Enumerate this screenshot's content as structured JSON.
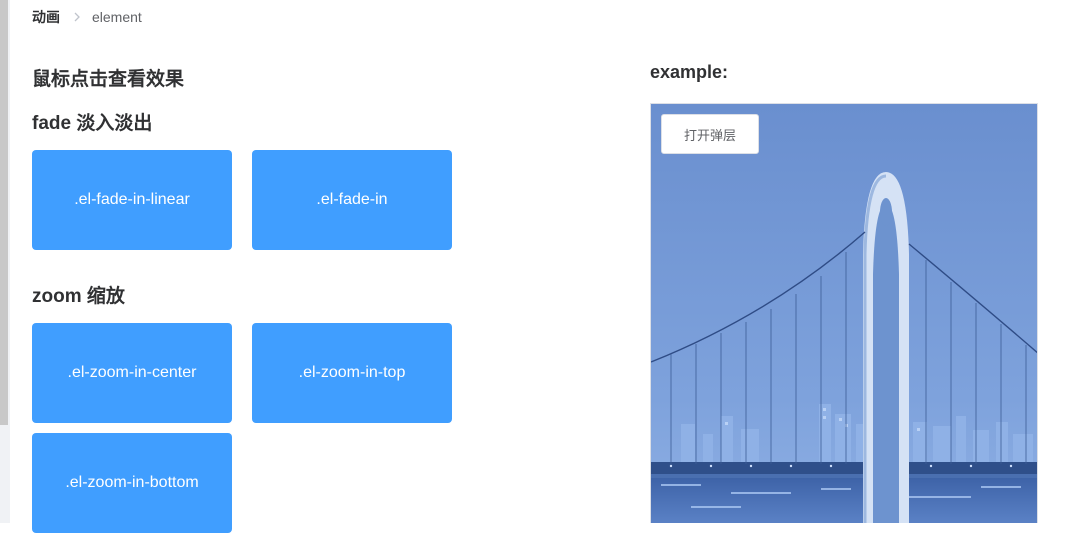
{
  "breadcrumb": {
    "root": "动画",
    "current": "element"
  },
  "main": {
    "heading": "鼠标点击查看效果",
    "fade": {
      "heading": "fade 淡入淡出",
      "boxes": [
        ".el-fade-in-linear",
        ".el-fade-in"
      ]
    },
    "zoom": {
      "heading": "zoom 缩放",
      "boxes": [
        ".el-zoom-in-center",
        ".el-zoom-in-top",
        ".el-zoom-in-bottom"
      ]
    }
  },
  "example": {
    "title": "example:",
    "open_button": "打开弹层"
  },
  "colors": {
    "primary": "#409eff",
    "text": "#303133",
    "border": "#dcdfe6"
  }
}
